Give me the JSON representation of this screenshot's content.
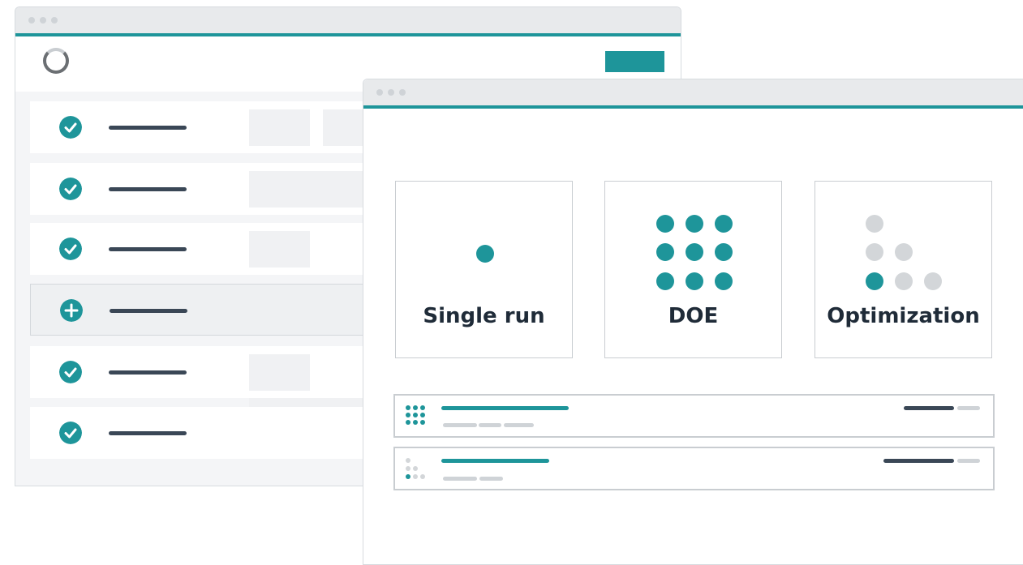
{
  "colors": {
    "accent": "#1e959a",
    "inactive_dot": "#d3d6d9",
    "dark_line": "#3a4756",
    "light_line": "#cfd3d7"
  },
  "back_window": {
    "logo_icon": "progress-ring-icon",
    "rows": [
      {
        "icon": "check-circle-icon",
        "state": "done"
      },
      {
        "icon": "check-circle-icon",
        "state": "done"
      },
      {
        "icon": "check-circle-icon",
        "state": "done"
      },
      {
        "icon": "plus-circle-icon",
        "state": "active"
      },
      {
        "icon": "check-circle-icon",
        "state": "done"
      },
      {
        "icon": "check-circle-icon",
        "state": "done"
      }
    ]
  },
  "front_window": {
    "cards": [
      {
        "label": "Single run",
        "icon": "single-dot-icon"
      },
      {
        "label": "DOE",
        "icon": "grid-dots-icon"
      },
      {
        "label": "Optimization",
        "icon": "staircase-dots-icon"
      }
    ],
    "list_items": [
      {
        "icon": "grid-dots-icon"
      },
      {
        "icon": "staircase-dots-icon"
      }
    ]
  }
}
